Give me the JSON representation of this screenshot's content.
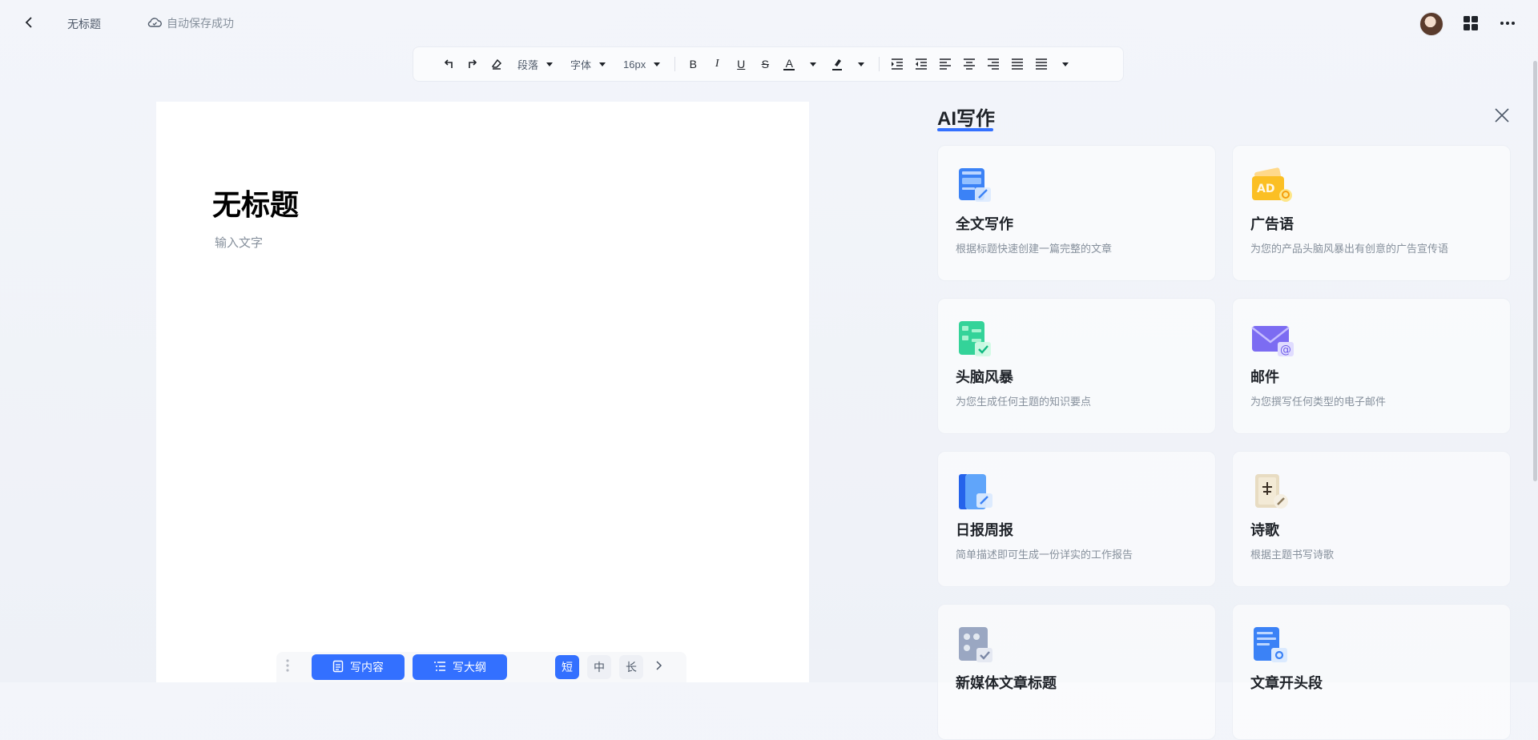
{
  "header": {
    "doc_title": "无标题",
    "save_status": "自动保存成功"
  },
  "toolbar": {
    "paragraph": "段落",
    "font": "字体",
    "size": "16px",
    "bold": "B",
    "italic": "I",
    "underline": "U",
    "strike": "S",
    "font_color": "A"
  },
  "editor": {
    "heading": "无标题",
    "placeholder": "输入文字"
  },
  "bottom_bar": {
    "write_content": "写内容",
    "write_outline": "写大纲",
    "lengths": [
      "短",
      "中",
      "长"
    ]
  },
  "ai_panel": {
    "title": "AI写作",
    "cards": [
      {
        "title": "全文写作",
        "desc": "根据标题快速创建一篇完整的文章",
        "icon": "document-write-icon"
      },
      {
        "title": "广告语",
        "desc": "为您的产品头脑风暴出有创意的广告宣传语",
        "icon": "ad-icon"
      },
      {
        "title": "头脑风暴",
        "desc": "为您生成任何主题的知识要点",
        "icon": "brainstorm-icon"
      },
      {
        "title": "邮件",
        "desc": "为您撰写任何类型的电子邮件",
        "icon": "mail-icon"
      },
      {
        "title": "日报周报",
        "desc": "简单描述即可生成一份详实的工作报告",
        "icon": "report-icon"
      },
      {
        "title": "诗歌",
        "desc": "根据主题书写诗歌",
        "icon": "poem-icon"
      },
      {
        "title": "新媒体文章标题",
        "desc": "",
        "icon": "media-title-icon"
      },
      {
        "title": "文章开头段",
        "desc": "",
        "icon": "article-opening-icon"
      }
    ]
  },
  "colors": {
    "accent": "#3370ff",
    "text": "#1f2329",
    "muted": "#86909c"
  }
}
